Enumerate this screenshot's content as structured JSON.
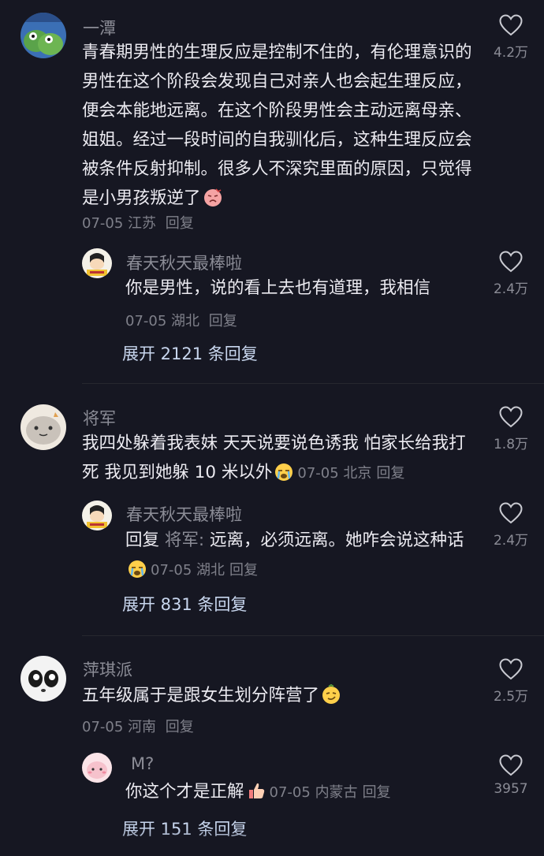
{
  "colors": {
    "background": "#161722",
    "username": "#8b8c96",
    "body_text": "#ecebf1",
    "meta_text": "#7f808a",
    "expand_link": "#c8d6ee"
  },
  "comments": [
    {
      "username": "一潭",
      "text": "青春期男性的生理反应是控制不住的，有伦理意识的男性在这个阶段会发现自己对亲人也会起生理反应，便会本能地远离。在这个阶段男性会主动远离母亲、姐姐。经过一段时间的自我驯化后，这种生理反应会被条件反射抑制。很多人不深究里面的原因，只觉得是小男孩叛逆了",
      "emoji": "angry-face-emoji",
      "date": "07-05",
      "location": "江苏",
      "reply_label": "回复",
      "likes": "4.2万",
      "reply": {
        "username": "春天秋天最棒啦",
        "text": "你是男性，说的看上去也有道理，我相信",
        "date": "07-05",
        "location": "湖北",
        "reply_label": "回复",
        "likes": "2.4万"
      },
      "expand_label": "展开 2121 条回复"
    },
    {
      "username": "将军",
      "text": "我四处躲着我表妹 天天说要说色诱我 怕家长给我打死 我见到她躲 10 米以外",
      "emoji": "crying-face-emoji",
      "date": "07-05",
      "location": "北京",
      "reply_label": "回复",
      "likes": "1.8万",
      "reply": {
        "username": "春天秋天最棒啦",
        "reply_prefix": "回复",
        "reply_target": "将军:",
        "text": " 远离，必须远离。她咋会说这种话",
        "emoji": "crying-face-emoji",
        "date": "07-05",
        "location": "湖北",
        "reply_label": "回复",
        "likes": "2.4万"
      },
      "expand_label": "展开 831 条回复"
    },
    {
      "username": "萍琪派",
      "text": "五年级属于是跟女生划分阵营了",
      "emoji": "smirk-face-emoji",
      "date": "07-05",
      "location": "河南",
      "reply_label": "回复",
      "likes": "2.5万",
      "reply": {
        "username": "M?",
        "text": "你这个才是正解",
        "emoji": "thumbs-up-emoji",
        "date": "07-05",
        "location": "内蒙古",
        "reply_label": "回复",
        "likes": "3957"
      },
      "expand_label": "展开 151 条回复"
    }
  ]
}
